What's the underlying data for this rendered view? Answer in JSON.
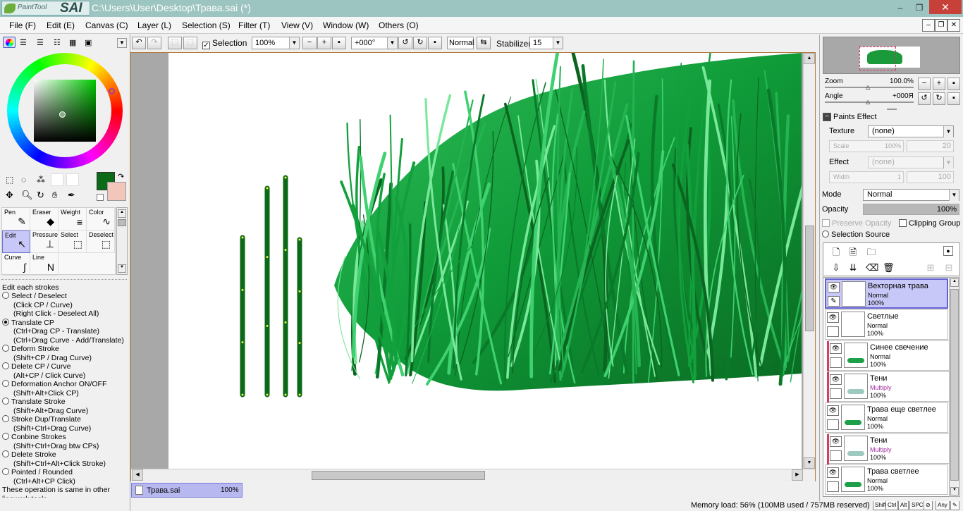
{
  "window": {
    "app_name_small": "PaintTool",
    "app_name_big": "SAI",
    "title": "C:\\Users\\User\\Desktop\\Трава.sai (*)",
    "minimize": "‒",
    "maximize": "❐",
    "close": "✕"
  },
  "menu": [
    "File (F)",
    "Edit (E)",
    "Canvas (C)",
    "Layer (L)",
    "Selection (S)",
    "Filter (T)",
    "View (V)",
    "Window (W)",
    "Others (O)"
  ],
  "toolbar": {
    "selection_label": "Selection",
    "selection_checked": "✓",
    "zoom_value": "100%",
    "angle_value": "+000°",
    "blend_value": "Normal",
    "stabilizer_label": "Stabilizer",
    "stabilizer_value": "15"
  },
  "colors": {
    "primary": "#0b6a17",
    "secondary": "#f3c6bb",
    "accent_selected_layer": "#c8c8f8",
    "clip_marker": "#d04060"
  },
  "tools": [
    {
      "label": "Pen",
      "icon": "✎"
    },
    {
      "label": "Eraser",
      "icon": "◆"
    },
    {
      "label": "Weight",
      "icon": "≡"
    },
    {
      "label": "Color",
      "icon": "∿"
    },
    {
      "label": "Edit",
      "icon": "↖"
    },
    {
      "label": "Pressure",
      "icon": "⊥"
    },
    {
      "label": "Select",
      "icon": "⬚"
    },
    {
      "label": "Deselect",
      "icon": "⬚"
    },
    {
      "label": "Curve",
      "icon": "∫"
    },
    {
      "label": "Line",
      "icon": "N"
    }
  ],
  "tool_options": {
    "heading": "Edit each strokes",
    "options": [
      {
        "title": "Select / Deselect",
        "lines": [
          "(Click CP / Curve)",
          "(Right Click - Deselect All)"
        ],
        "selected": false
      },
      {
        "title": "Translate CP",
        "lines": [
          "(Ctrl+Drag CP - Translate)",
          "(Ctrl+Drag Curve - Add/Translate)"
        ],
        "selected": true
      },
      {
        "title": "Deform Stroke",
        "lines": [
          "(Shift+CP / Drag Curve)"
        ],
        "selected": false
      },
      {
        "title": "Delete CP / Curve",
        "lines": [
          "(Alt+CP / Click Curve)"
        ],
        "selected": false
      },
      {
        "title": "Deformation Anchor ON/OFF",
        "lines": [
          "(Shift+Alt+Click CP)"
        ],
        "selected": false
      },
      {
        "title": "Translate Stroke",
        "lines": [
          "(Shift+Alt+Drag Curve)"
        ],
        "selected": false
      },
      {
        "title": "Stroke Dup/Translate",
        "lines": [
          "(Shift+Ctrl+Drag Curve)"
        ],
        "selected": false
      },
      {
        "title": "Conbine Strokes",
        "lines": [
          "(Shift+Ctrl+Drag btw CPs)"
        ],
        "selected": false
      },
      {
        "title": "Delete Stroke",
        "lines": [
          "(Shift+Ctrl+Alt+Click Stroke)"
        ],
        "selected": false
      },
      {
        "title": "Pointed / Rounded",
        "lines": [
          "(Ctrl+Alt+CP Click)"
        ],
        "selected": false
      }
    ],
    "footer_1": "These operation is same in other",
    "footer_2": "linework tools"
  },
  "document_tab": {
    "name": "Трава.sai",
    "zoom": "100%"
  },
  "status": {
    "memory": "Memory load: 56% (100MB used / 757MB reserved)",
    "keys": [
      "Shift",
      "Ctrl",
      "Alt",
      "SPC",
      "⊘",
      "Any",
      "✎"
    ]
  },
  "navigator": {
    "zoom_label": "Zoom",
    "zoom_value": "100.0%",
    "angle_label": "Angle",
    "angle_value": "+000Я"
  },
  "paints_effect": {
    "heading": "Paints Effect",
    "texture_label": "Texture",
    "texture_value": "(none)",
    "scale_label": "Scale",
    "scale_value": "100%",
    "scale_num": "20",
    "effect_label": "Effect",
    "effect_value": "(none)",
    "width_label": "Width",
    "width_value": "1",
    "width_num": "100"
  },
  "layer_props": {
    "mode_label": "Mode",
    "mode_value": "Normal",
    "opacity_label": "Opacity",
    "opacity_value": "100%",
    "opacity_level": 1.0,
    "preserve_opacity": "Preserve Opacity",
    "clipping_group": "Clipping Group",
    "selection_source": "Selection Source"
  },
  "layers": [
    {
      "name": "Векторная трава",
      "mode": "Normal",
      "opacity": "100%",
      "selected": true,
      "clipped": false,
      "multiply": false,
      "pen": "✎"
    },
    {
      "name": "Светлые",
      "mode": "Normal",
      "opacity": "100%",
      "selected": false,
      "clipped": false,
      "multiply": false,
      "pen": ""
    },
    {
      "name": "Синее свечение",
      "mode": "Normal",
      "opacity": "100%",
      "selected": false,
      "clipped": true,
      "multiply": false,
      "pen": ""
    },
    {
      "name": "Тени",
      "mode": "Multiply",
      "opacity": "100%",
      "selected": false,
      "clipped": true,
      "multiply": true,
      "pen": ""
    },
    {
      "name": "Трава еще светлее",
      "mode": "Normal",
      "opacity": "100%",
      "selected": false,
      "clipped": false,
      "multiply": false,
      "pen": ""
    },
    {
      "name": "Тени",
      "mode": "Multiply",
      "opacity": "100%",
      "selected": false,
      "clipped": true,
      "multiply": true,
      "pen": ""
    },
    {
      "name": "Трава светлее",
      "mode": "Normal",
      "opacity": "100%",
      "selected": false,
      "clipped": false,
      "multiply": false,
      "pen": ""
    }
  ]
}
